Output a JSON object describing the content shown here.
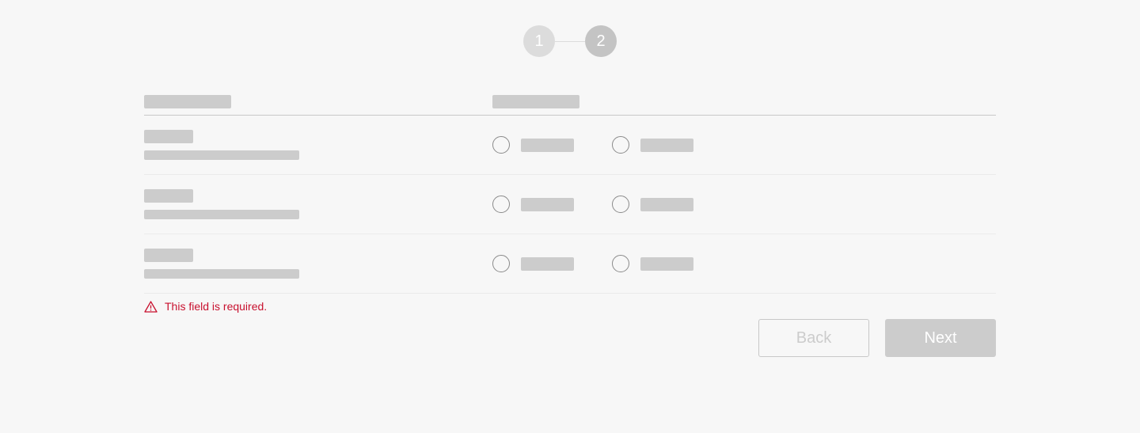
{
  "stepper": {
    "steps": [
      {
        "label": "1",
        "state": "completed"
      },
      {
        "label": "2",
        "state": "active"
      }
    ]
  },
  "table": {
    "columns": [
      "skeleton-placeholder",
      "skeleton-placeholder"
    ],
    "rows": [
      {
        "title": "skeleton",
        "description": "skeleton",
        "options": [
          "skeleton",
          "skeleton"
        ],
        "selected": null
      },
      {
        "title": "skeleton",
        "description": "skeleton",
        "options": [
          "skeleton",
          "skeleton"
        ],
        "selected": null
      },
      {
        "title": "skeleton",
        "description": "skeleton",
        "options": [
          "skeleton",
          "skeleton"
        ],
        "selected": null
      }
    ]
  },
  "validation": {
    "icon": "warning-triangle-icon",
    "message": "This field is required."
  },
  "actions": {
    "back_label": "Back",
    "next_label": "Next"
  },
  "colors": {
    "background": "#f7f7f7",
    "skeleton": "#cccccc",
    "error": "#c8102e"
  }
}
